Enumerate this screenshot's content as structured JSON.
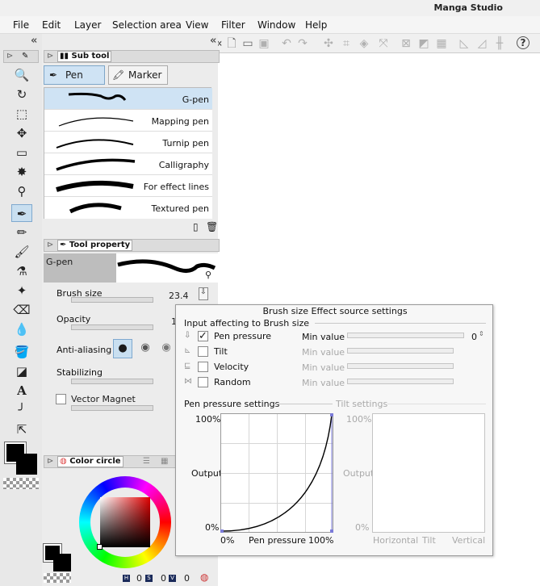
{
  "app": {
    "title": "Manga Studio"
  },
  "menu": [
    "File",
    "Edit",
    "Layer",
    "Selection area",
    "View",
    "Filter",
    "Window",
    "Help"
  ],
  "subtool_panel": {
    "tab_label": "Sub tool",
    "tabs": [
      "Pen",
      "Marker"
    ],
    "pens": [
      "G-pen",
      "Mapping pen",
      "Turnip pen",
      "Calligraphy",
      "For effect lines",
      "Textured pen"
    ],
    "selected_pen": "G-pen"
  },
  "tool_property": {
    "tab_label": "Tool property",
    "tool_name": "G-pen",
    "brush_size_label": "Brush size",
    "brush_size_value": "23.4",
    "opacity_label": "Opacity",
    "opacity_value": "1",
    "anti_aliasing_label": "Anti-aliasing",
    "stabilizing_label": "Stabilizing",
    "vector_magnet_label": "Vector Magnet"
  },
  "color_panel": {
    "tab_label": "Color circle",
    "h_label": "H",
    "h_value": "0",
    "s_label": "S",
    "s_value": "0",
    "v_label": "V",
    "v_value": "0"
  },
  "dialog": {
    "title": "Brush size Effect source settings",
    "section_label": "Input affecting to Brush size",
    "inputs": [
      {
        "label": "Pen pressure",
        "checked": true,
        "min_label": "Min value",
        "min_value": "0"
      },
      {
        "label": "Tilt",
        "checked": false,
        "min_label": "Min value"
      },
      {
        "label": "Velocity",
        "checked": false,
        "min_label": "Min value"
      },
      {
        "label": "Random",
        "checked": false,
        "min_label": "Min value"
      }
    ],
    "pen_pressure_settings": {
      "label": "Pen pressure settings",
      "y_max": "100%",
      "y_mid": "Output",
      "y_min": "0%",
      "x_min": "0%",
      "x_label": "Pen pressure",
      "x_max": "100%"
    },
    "tilt_settings": {
      "label": "Tilt settings",
      "y_max": "100%",
      "y_mid": "Output",
      "y_min": "0%",
      "x_left": "Horizontal",
      "x_mid": "Tilt",
      "x_right": "Vertical"
    }
  },
  "colors": {
    "selection": "#cfe3f4",
    "canvas": "#ffffff",
    "panel": "#ececec"
  }
}
